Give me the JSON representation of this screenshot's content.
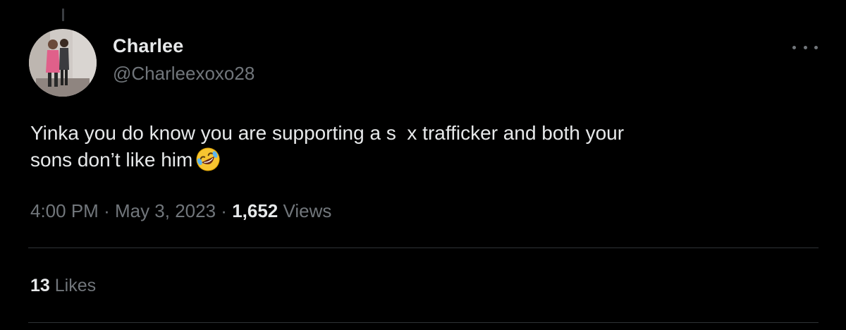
{
  "author": {
    "display_name": "Charlee",
    "handle": "@Charleexoxo28"
  },
  "tweet": {
    "text": "Yinka you do know you are supporting a s  x trafficker and both your\nsons don’t like him",
    "emoji": "rolling-on-the-floor-laughing"
  },
  "meta": {
    "time": "4:00 PM",
    "separator": "·",
    "date": "May 3, 2023",
    "views_count": "1,652",
    "views_label": "Views"
  },
  "engagement": {
    "likes_count": "13",
    "likes_label": "Likes"
  },
  "icons": {
    "more": "more-horizontal-icon"
  },
  "colors": {
    "background": "#000000",
    "primary_text": "#e7e9ea",
    "secondary_text": "#71767b",
    "divider": "#2f3336"
  }
}
